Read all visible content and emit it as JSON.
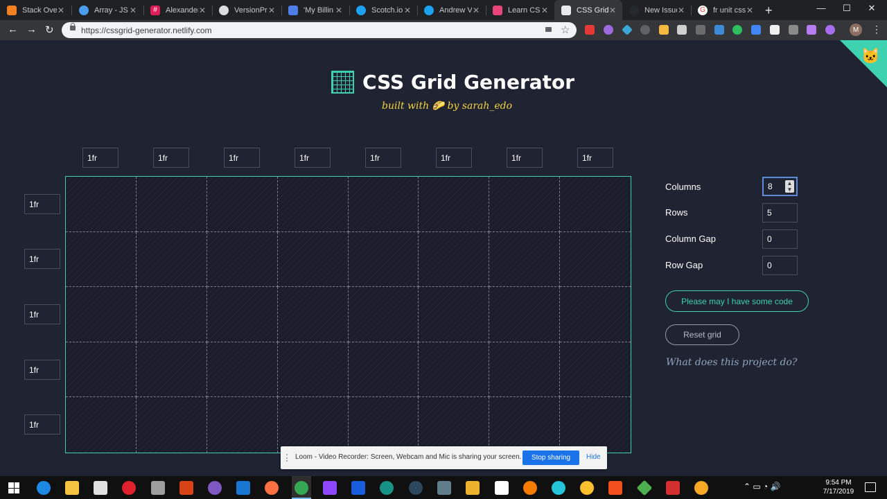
{
  "browser": {
    "tabs": [
      {
        "title": "Stack Over",
        "icon": "stackoverflow-icon",
        "color": "#f48024"
      },
      {
        "title": "Array - JS",
        "icon": "jsperf-icon",
        "color": "#4a9eed"
      },
      {
        "title": "Alexander",
        "icon": "slack-icon",
        "color": "#e01e5a"
      },
      {
        "title": "VersionPre",
        "icon": "globe-icon",
        "color": "#dadce0"
      },
      {
        "title": "'My Billin",
        "icon": "billing-icon",
        "color": "#4f7ee8"
      },
      {
        "title": "Scotch.io",
        "icon": "twitter-icon",
        "color": "#1da1f2"
      },
      {
        "title": "Andrew V",
        "icon": "twitter-icon",
        "color": "#1da1f2"
      },
      {
        "title": "Learn CSS",
        "icon": "learn-css-icon",
        "color": "#e8457a"
      },
      {
        "title": "CSS Grid",
        "icon": "grid-icon",
        "color": "#e8eaed",
        "active": true
      },
      {
        "title": "New Issue",
        "icon": "github-icon",
        "color": "#24292e"
      },
      {
        "title": "fr unit css",
        "icon": "google-icon",
        "color": "#ea4335"
      }
    ],
    "new_tab": "+",
    "url": "https://cssgrid-generator.netlify.com",
    "avatar_letter": "M"
  },
  "page": {
    "title": "CSS Grid Generator",
    "subtitle_pre": "built with",
    "subtitle_post": "by sarah_edo",
    "column_values": [
      "1fr",
      "1fr",
      "1fr",
      "1fr",
      "1fr",
      "1fr",
      "1fr",
      "1fr"
    ],
    "row_values": [
      "1fr",
      "1fr",
      "1fr",
      "1fr",
      "1fr"
    ],
    "controls": {
      "columns_label": "Columns",
      "columns_value": "8",
      "rows_label": "Rows",
      "rows_value": "5",
      "column_gap_label": "Column Gap",
      "column_gap_value": "0",
      "row_gap_label": "Row Gap",
      "row_gap_value": "0"
    },
    "code_button": "Please may I have some code",
    "reset_button": "Reset grid",
    "project_link": "What does this project do?",
    "accent_color": "#3fd2b1"
  },
  "loom": {
    "message": "Loom - Video Recorder: Screen, Webcam and Mic is sharing your screen.",
    "stop_label": "Stop sharing",
    "hide_label": "Hide"
  },
  "taskbar": {
    "time": "9:54 PM",
    "date": "7/17/2019"
  }
}
